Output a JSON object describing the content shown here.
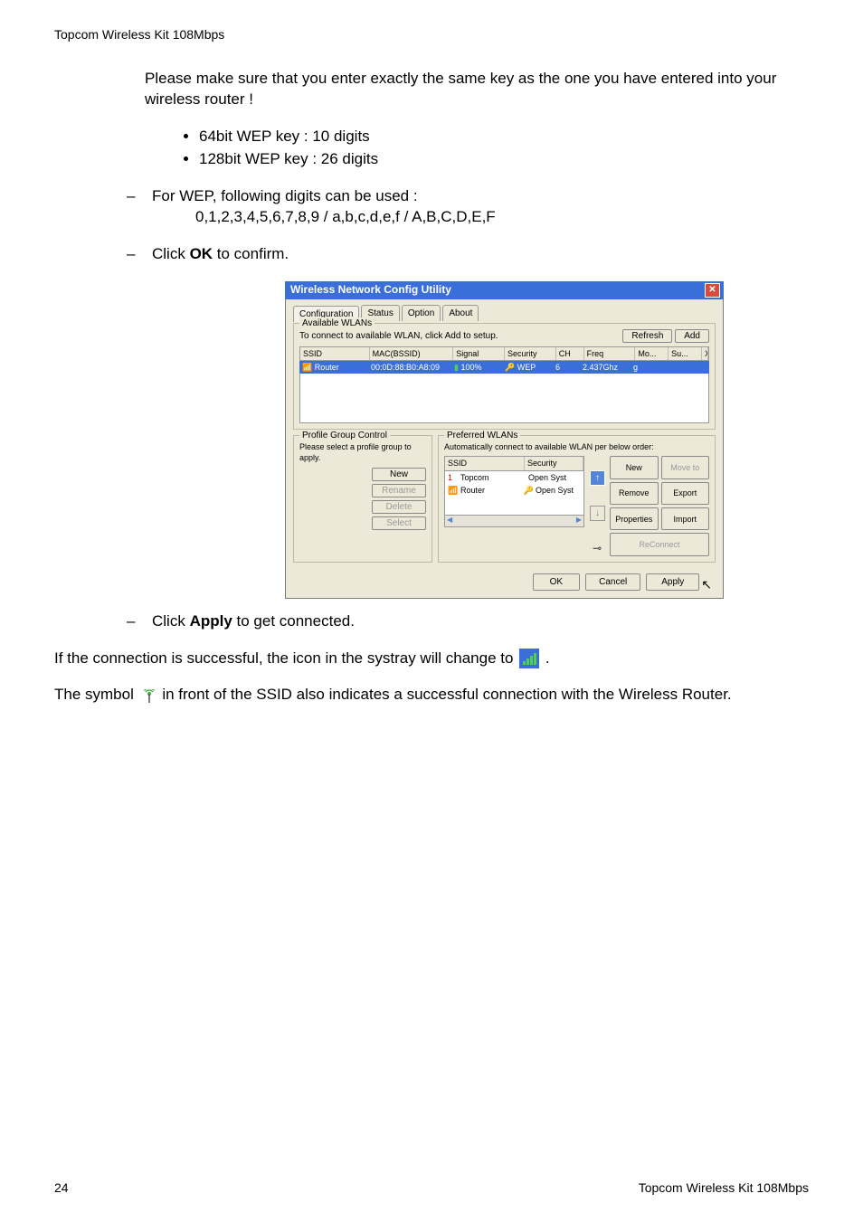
{
  "header": {
    "title": "Topcom Wireless Kit 108Mbps"
  },
  "body": {
    "p1": "Please make sure that you enter exactly the same key as the one you have entered into your wireless router !",
    "bullets": {
      "b1": "64bit WEP key : 10 digits",
      "b2": "128bit WEP key : 26 digits"
    },
    "p2": "For WEP, following digits can be used :",
    "p2b": "0,1,2,3,4,5,6,7,8,9 / a,b,c,d,e,f / A,B,C,D,E,F",
    "p3a": "Click ",
    "p3b": "OK",
    "p3c": " to confirm.",
    "p4a": "Click ",
    "p4b": "Apply",
    "p4c": " to get connected.",
    "p5a": "If the connection is successful, the icon in the systray will change to ",
    "p5b": " .",
    "p6a": "The symbol ",
    "p6b": "  in front of the SSID also indicates a successful connection with  the Wireless Router."
  },
  "dlg": {
    "title": "Wireless Network Config Utility",
    "tabs": {
      "t1": "Configuration",
      "t2": "Status",
      "t3": "Option",
      "t4": "About"
    },
    "avail": {
      "label": "Available WLANs",
      "hint": "To connect to available WLAN, click Add to setup.",
      "refresh": "Refresh",
      "add": "Add",
      "cols": {
        "ssid": "SSID",
        "mac": "MAC(BSSID)",
        "signal": "Signal",
        "sec": "Security",
        "ch": "CH",
        "freq": "Freq",
        "mode": "Mo...",
        "su": "Su...",
        "xr": "XR"
      },
      "row": {
        "ssid": "Router",
        "mac": "00:0D:88:B0:A8:09",
        "signal": "100%",
        "sec": "WEP",
        "ch": "6",
        "freq": "2.437Ghz",
        "mode": "g"
      }
    },
    "pgc": {
      "label": "Profile Group Control",
      "hint": "Please select a profile group to apply.",
      "new": "New",
      "rename": "Rename",
      "delete": "Delete",
      "select": "Select"
    },
    "pref": {
      "label": "Preferred WLANs",
      "hint": "Automatically connect to available WLAN per below order:",
      "cols": {
        "ssid": "SSID",
        "sec": "Security"
      },
      "rows": {
        "r1": {
          "idx": "1",
          "ssid": "Topcom",
          "sec": "Open Syst"
        },
        "r2": {
          "ssid": "Router",
          "sec": "Open Syst"
        }
      },
      "btns": {
        "new": "New",
        "move": "Move to",
        "remove": "Remove",
        "export": "Export",
        "props": "Properties",
        "import": "Import",
        "reconn": "ReConnect"
      }
    },
    "bottom": {
      "ok": "OK",
      "cancel": "Cancel",
      "apply": "Apply"
    }
  },
  "footer": {
    "page": "24",
    "prod": "Topcom Wireless Kit 108Mbps"
  }
}
